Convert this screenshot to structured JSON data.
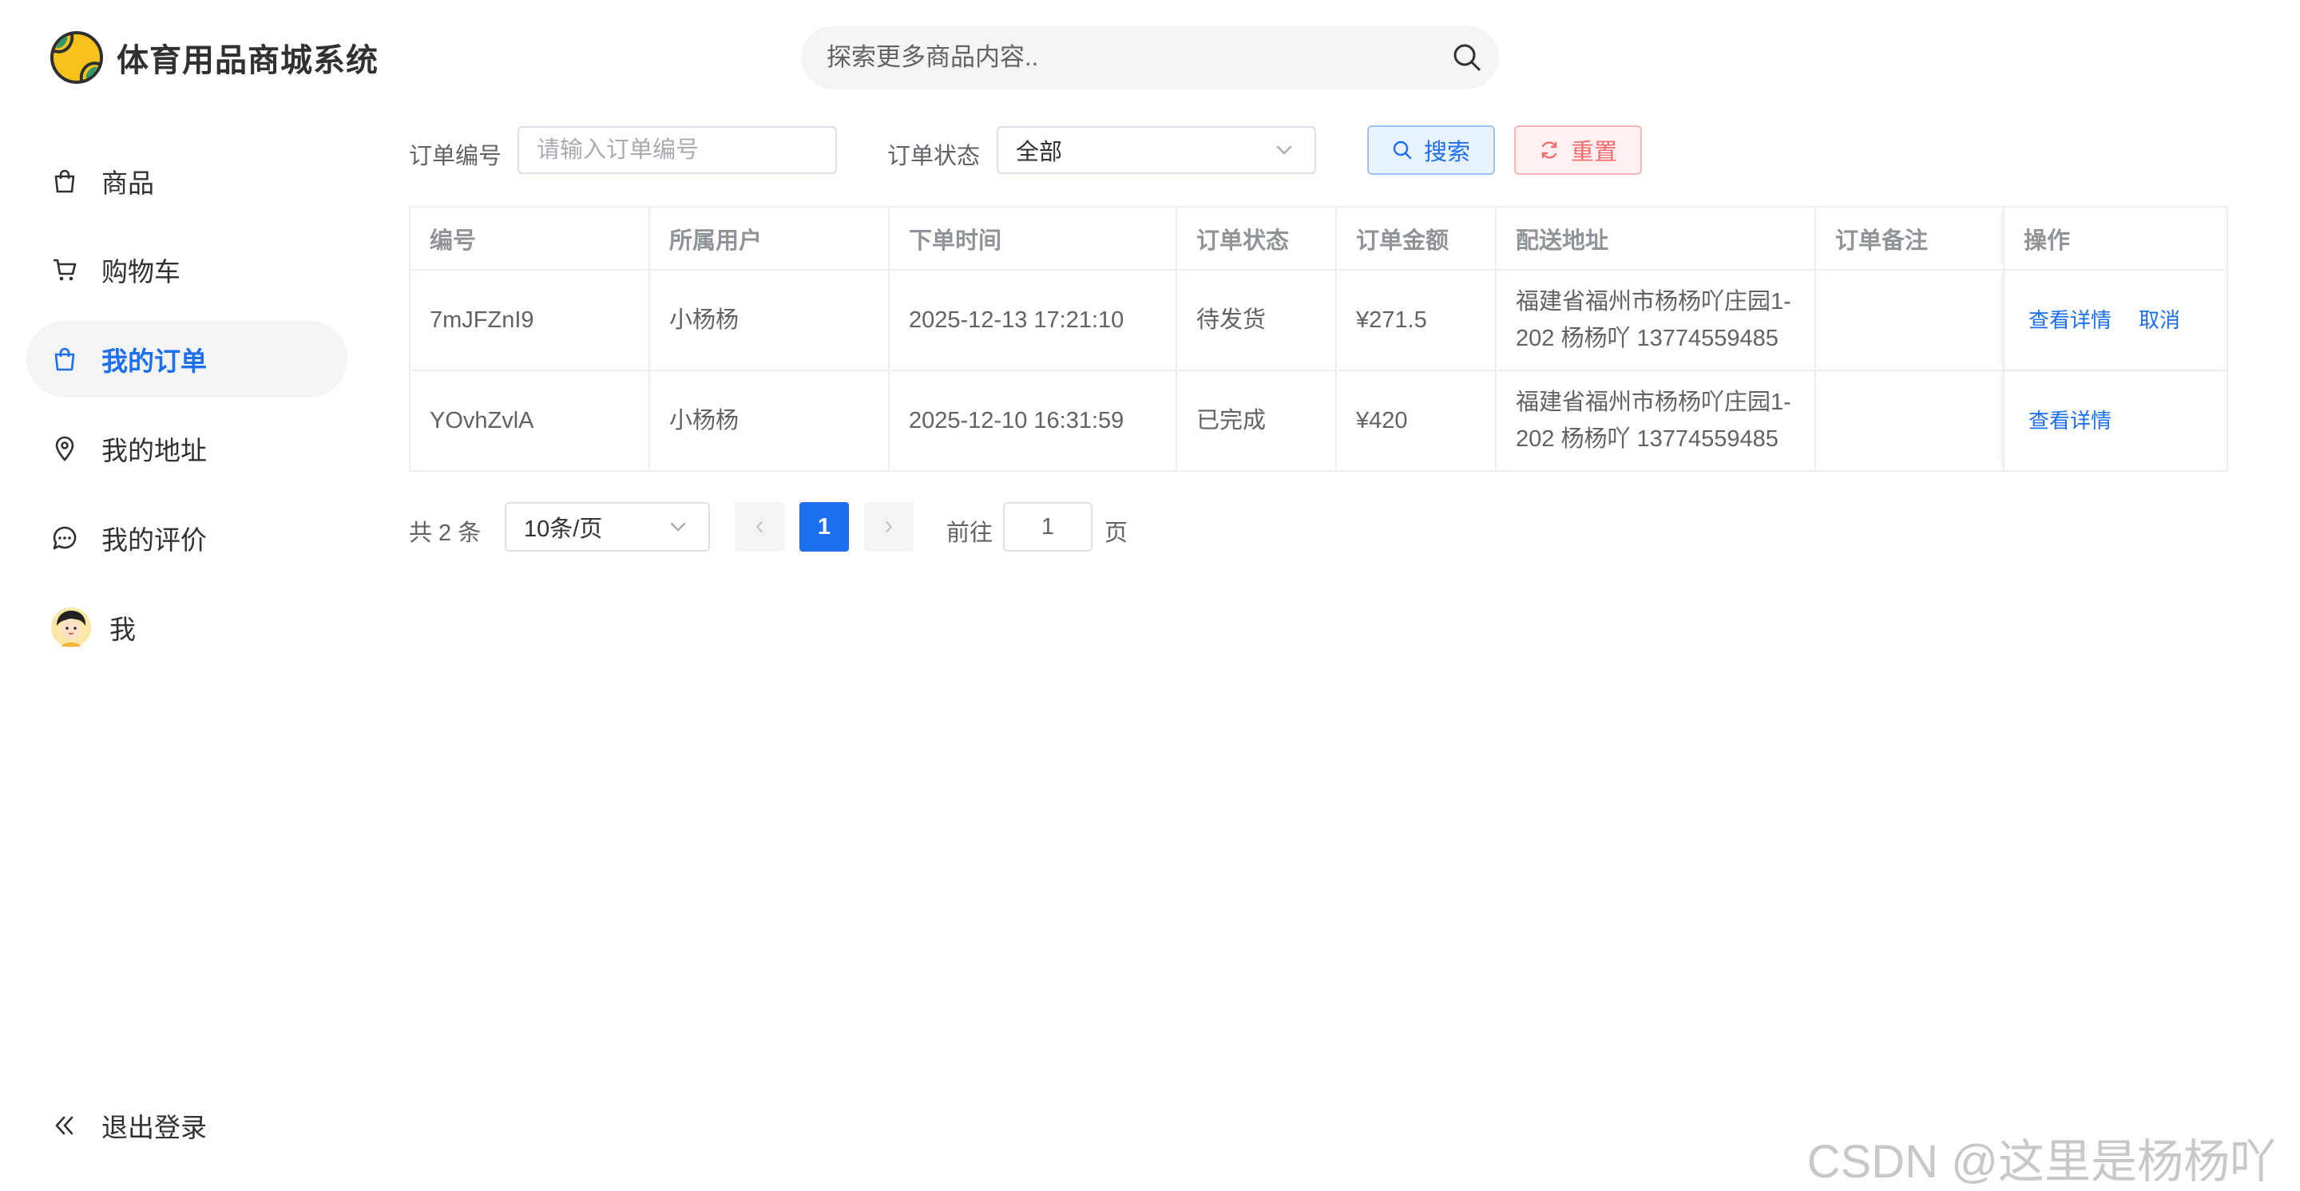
{
  "app": {
    "title": "体育用品商城系统"
  },
  "search": {
    "placeholder": "探索更多商品内容.."
  },
  "sidebar": {
    "items": [
      {
        "label": "商品",
        "icon": "shopping-bag-icon"
      },
      {
        "label": "购物车",
        "icon": "shopping-cart-icon"
      },
      {
        "label": "我的订单",
        "icon": "order-bag-icon",
        "active": true
      },
      {
        "label": "我的地址",
        "icon": "location-pin-icon"
      },
      {
        "label": "我的评价",
        "icon": "chat-bubble-icon"
      },
      {
        "label": "我",
        "icon": "avatar"
      }
    ],
    "logout_label": "退出登录"
  },
  "filters": {
    "order_no_label": "订单编号",
    "order_no_placeholder": "请输入订单编号",
    "order_no_value": "",
    "status_label": "订单状态",
    "status_value": "全部",
    "search_button": "搜索",
    "reset_button": "重置"
  },
  "table": {
    "headers": [
      "编号",
      "所属用户",
      "下单时间",
      "订单状态",
      "订单金额",
      "配送地址",
      "订单备注",
      "操作"
    ],
    "rows": [
      {
        "id": "7mJFZnI9",
        "user": "小杨杨",
        "time": "2025-12-13 17:21:10",
        "status": "待发货",
        "amount": "¥271.5",
        "address_line1": "福建省福州市杨杨吖庄园1-",
        "address_line2": "202 杨杨吖 13774559485",
        "remark": "",
        "actions": [
          "查看详情",
          "取消"
        ]
      },
      {
        "id": "YOvhZvlA",
        "user": "小杨杨",
        "time": "2025-12-10 16:31:59",
        "status": "已完成",
        "amount": "¥420",
        "address_line1": "福建省福州市杨杨吖庄园1-",
        "address_line2": "202 杨杨吖 13774559485",
        "remark": "",
        "actions": [
          "查看详情"
        ]
      }
    ]
  },
  "pagination": {
    "total_text": "共 2 条",
    "page_size": "10条/页",
    "current_page": "1",
    "goto_label": "前往",
    "goto_value": "1",
    "page_suffix": "页"
  },
  "colors": {
    "accent": "#1d6ff2",
    "danger": "#f56c6c",
    "active_bg": "#f4f4f5"
  },
  "watermark": "CSDN @这里是杨杨吖"
}
